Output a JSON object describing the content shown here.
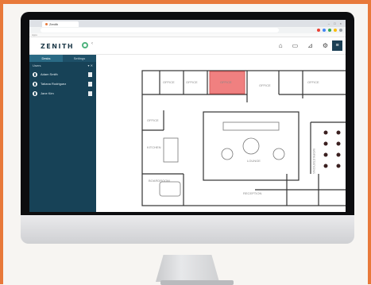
{
  "browser": {
    "tab_title": "Zenith",
    "window_controls": "– □ ×",
    "bookmarks_label": "Apps"
  },
  "app": {
    "logo_text": "ZENITH",
    "brand_color": "#4fb37e",
    "header_icons": [
      "home-icon",
      "layers-icon",
      "filter-icon",
      "settings-icon"
    ],
    "menu_icon": "≡"
  },
  "sidebar": {
    "tabs": [
      "Desks",
      "Settings"
    ],
    "section_label": "Users",
    "items": [
      {
        "label": "Adam Smith"
      },
      {
        "label": "Tatiana Rodriguez"
      },
      {
        "label": "Jane Kim"
      }
    ]
  },
  "floorplan": {
    "labels": {
      "office_a": "OFFICE",
      "office_b": "OFFICE",
      "office_c": "OFFICE",
      "office_d": "OFFICE",
      "office_e": "OFFICE",
      "office_f": "OFFICE",
      "lounge": "LOUNGE",
      "boardroom": "BOARDROOM",
      "reception": "RECEPTION",
      "workstations": "WORKSTATIONS",
      "kitchen": "KITCHEN"
    },
    "highlight_color": "#f08080"
  }
}
